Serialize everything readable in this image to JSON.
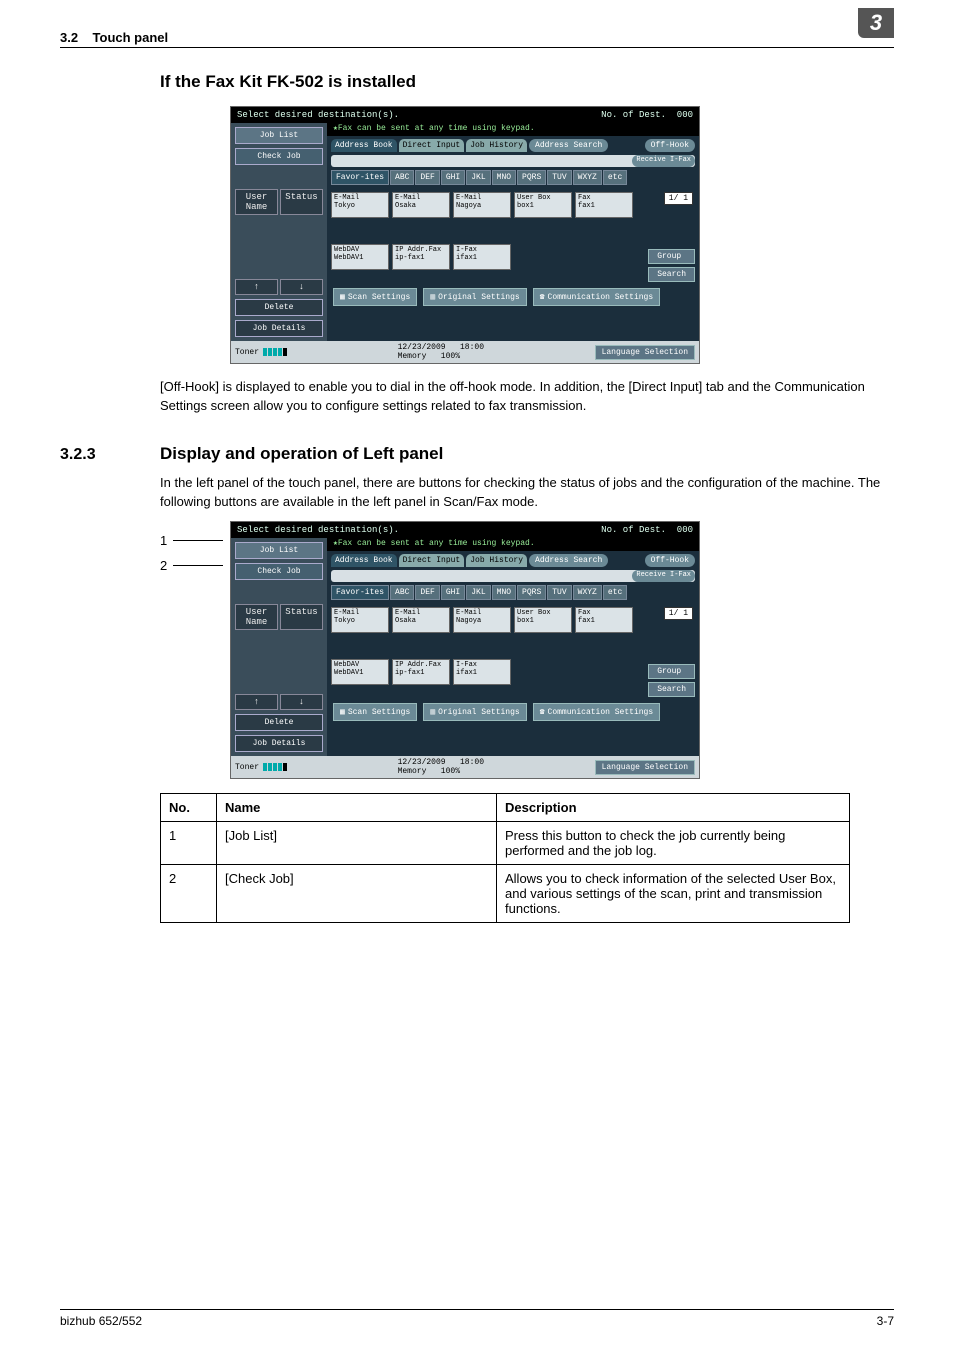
{
  "header": {
    "section": "3.2",
    "title": "Touch panel",
    "chapter": "3"
  },
  "heading1": "If the Fax Kit FK-502 is installed",
  "para1": "[Off-Hook] is displayed to enable you to dial in the off-hook mode. In addition, the [Direct Input] tab and the Communication Settings screen allow you to configure settings related to fax transmission.",
  "sec": {
    "num": "3.2.3",
    "title": "Display and operation of Left panel"
  },
  "para2": "In the left panel of the touch panel, there are buttons for checking the status of jobs and the configuration of the machine. The following buttons are available in the left panel in Scan/Fax mode.",
  "callouts": [
    "1",
    "2"
  ],
  "panel": {
    "top_msg": "Select desired destination(s).",
    "dest_label": "No. of Dest.",
    "dest_count": "000",
    "hint": "Fax can be sent at any time using keypad.",
    "side": {
      "job_list": "Job List",
      "check_job": "Check Job",
      "user_name": "User Name",
      "status": "Status",
      "up": "↑",
      "down": "↓",
      "delete": "Delete",
      "job_details": "Job Details",
      "toner": "Toner"
    },
    "tabs": {
      "address_book": "Address Book",
      "direct_input": "Direct Input",
      "job_history": "Job History",
      "address_search": "Address Search",
      "off_hook": "Off-Hook",
      "receive_ifax": "Receive I-Fax"
    },
    "alpha": [
      "Favor-ites",
      "ABC",
      "DEF",
      "GHI",
      "JKL",
      "MNO",
      "PQRS",
      "TUV",
      "WXYZ",
      "etc"
    ],
    "cards": [
      {
        "l1": "E-Mail",
        "l2": "Tokyo"
      },
      {
        "l1": "E-Mail",
        "l2": "Osaka"
      },
      {
        "l1": "E-Mail",
        "l2": "Nagoya"
      },
      {
        "l1": "User Box",
        "l2": "box1"
      },
      {
        "l1": "Fax",
        "l2": "fax1"
      },
      {
        "l1": "WebDAV",
        "l2": "WebDAV1"
      },
      {
        "l1": "IP Addr.Fax",
        "l2": "ip-fax1"
      },
      {
        "l1": "I-Fax",
        "l2": "ifax1"
      }
    ],
    "page_ind": "1/ 1",
    "group": "Group",
    "search": "Search",
    "bottom": {
      "scan_settings": "Scan Settings",
      "original_settings": "Original Settings",
      "comm_settings": "Communication Settings"
    },
    "footer": {
      "date": "12/23/2009",
      "time": "18:00",
      "memory": "Memory",
      "pct": "100%",
      "lang": "Language Selection"
    }
  },
  "table": {
    "headers": [
      "No.",
      "Name",
      "Description"
    ],
    "rows": [
      {
        "no": "1",
        "name": "[Job List]",
        "desc": "Press this button to check the job currently being performed and the job log."
      },
      {
        "no": "2",
        "name": "[Check Job]",
        "desc": "Allows you to check information of the selected User Box, and various settings of the scan, print and transmission functions."
      }
    ]
  },
  "footer": {
    "left": "bizhub 652/552",
    "right": "3-7"
  }
}
